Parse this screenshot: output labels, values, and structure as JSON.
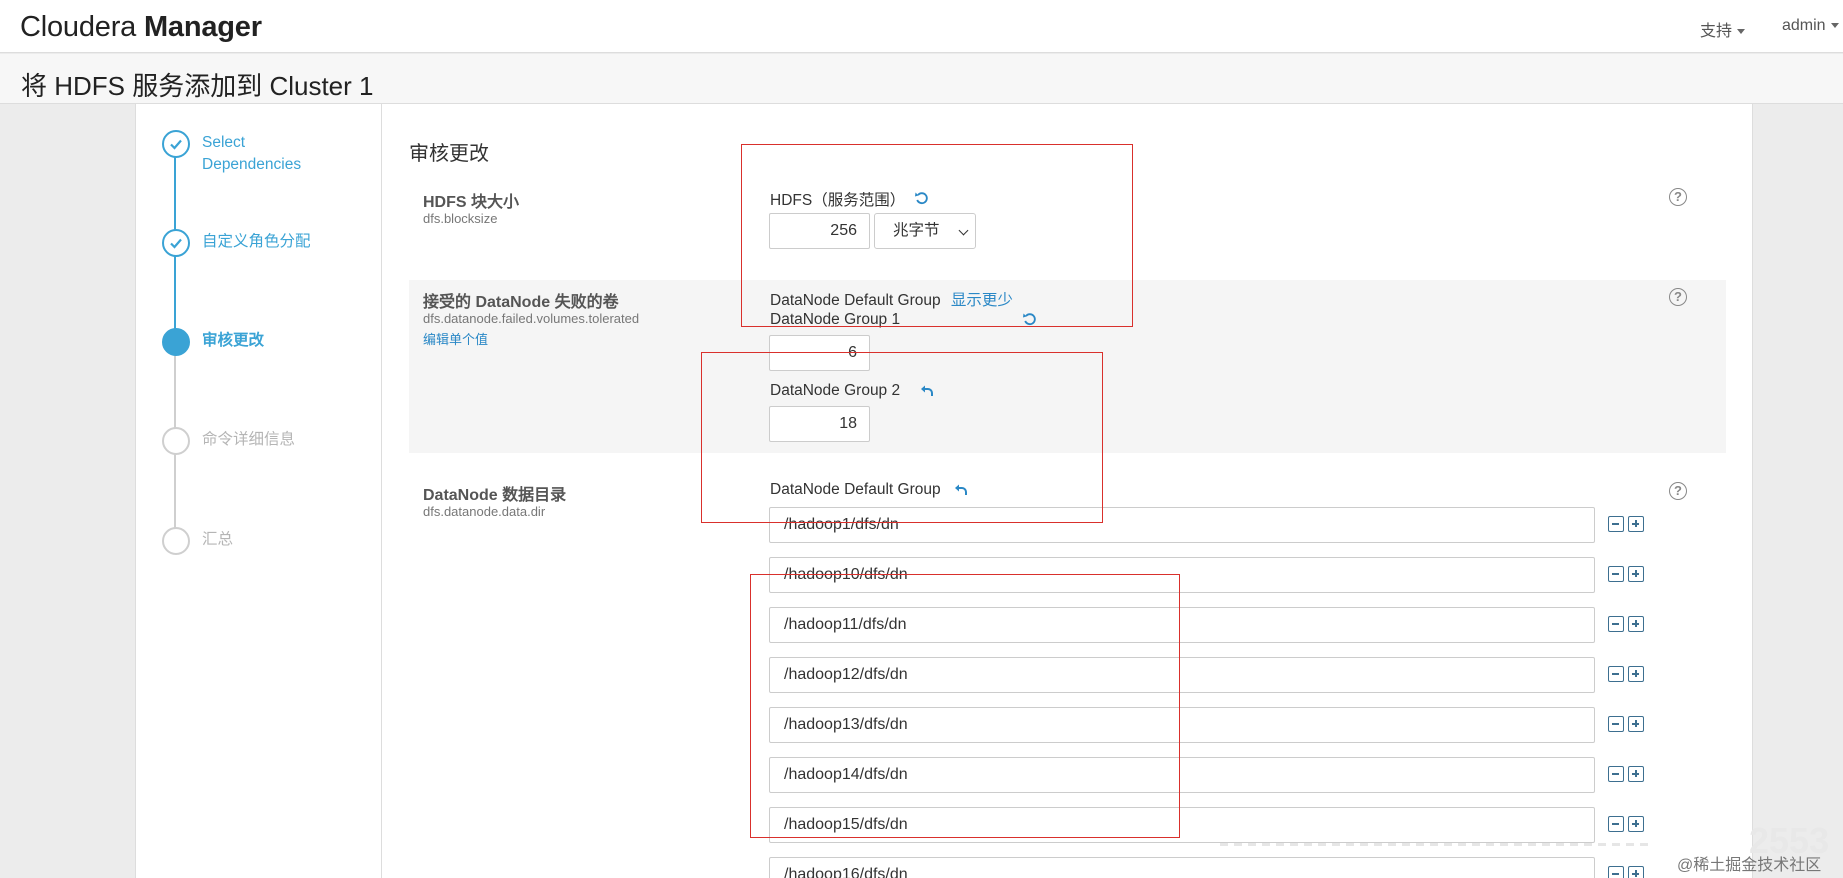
{
  "header": {
    "brand_light": "Cloudera",
    "brand_bold": "Manager",
    "support_label": "支持",
    "user_label": "admin"
  },
  "page": {
    "title": "将 HDFS 服务添加到 Cluster 1"
  },
  "wizard": {
    "steps": [
      {
        "label": "Select Dependencies",
        "state": "done"
      },
      {
        "label": "自定义角色分配",
        "state": "done"
      },
      {
        "label": "审核更改",
        "state": "current"
      },
      {
        "label": "命令详细信息",
        "state": "todo"
      },
      {
        "label": "汇总",
        "state": "todo"
      }
    ]
  },
  "review": {
    "section_title": "审核更改",
    "properties": [
      {
        "name": "HDFS 块大小",
        "key": "dfs.blocksize",
        "scope_label": "HDFS（服务范围）",
        "value": "256",
        "unit": "兆字节"
      },
      {
        "name": "接受的 DataNode 失败的卷",
        "key": "dfs.datanode.failed.volumes.tolerated",
        "edit_link": "编辑单个值",
        "default_group_label": "DataNode Default Group",
        "show_less_link": "显示更少",
        "groups": [
          {
            "label": "DataNode Group 1",
            "value": "6"
          },
          {
            "label": "DataNode Group 2",
            "value": "18"
          }
        ]
      },
      {
        "name": "DataNode 数据目录",
        "key": "dfs.datanode.data.dir",
        "group_label": "DataNode Default Group",
        "dirs": [
          "/hadoop1/dfs/dn",
          "/hadoop10/dfs/dn",
          "/hadoop11/dfs/dn",
          "/hadoop12/dfs/dn",
          "/hadoop13/dfs/dn",
          "/hadoop14/dfs/dn",
          "/hadoop15/dfs/dn",
          "/hadoop16/dfs/dn"
        ]
      }
    ]
  },
  "watermark": {
    "text": "@稀土掘金技术社区",
    "number": "2553"
  },
  "colors": {
    "accent": "#3aa3d5",
    "link": "#2a88c6",
    "annotation_red": "#d9302c"
  },
  "icons": [
    "check-icon",
    "undo-icon",
    "redo-back-icon",
    "help-icon",
    "minus-icon",
    "plus-icon",
    "caret-down-icon"
  ]
}
